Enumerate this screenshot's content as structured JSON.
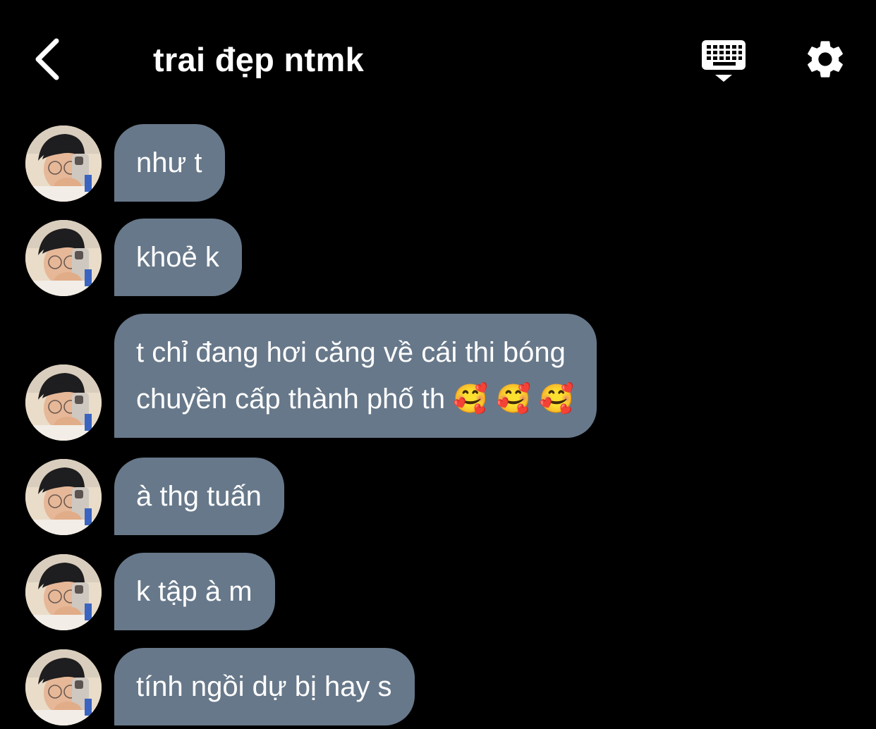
{
  "header": {
    "title": "trai đẹp ntmk",
    "back_icon": "chevron-left-icon",
    "keyboard_icon": "keyboard-hide-icon",
    "settings_icon": "gear-icon"
  },
  "colors": {
    "background": "#000000",
    "bubble": "#67788a",
    "text": "#ffffff"
  },
  "messages": [
    {
      "text": "như t"
    },
    {
      "text": "khoẻ k"
    },
    {
      "line1": "t chỉ đang hơi căng về cái thi bóng",
      "line2": "chuyền cấp thành phố th 🥰 🥰 🥰"
    },
    {
      "text": "à thg tuấn"
    },
    {
      "text": "k tập à m"
    },
    {
      "text": "tính ngồi dự bị hay s"
    }
  ]
}
